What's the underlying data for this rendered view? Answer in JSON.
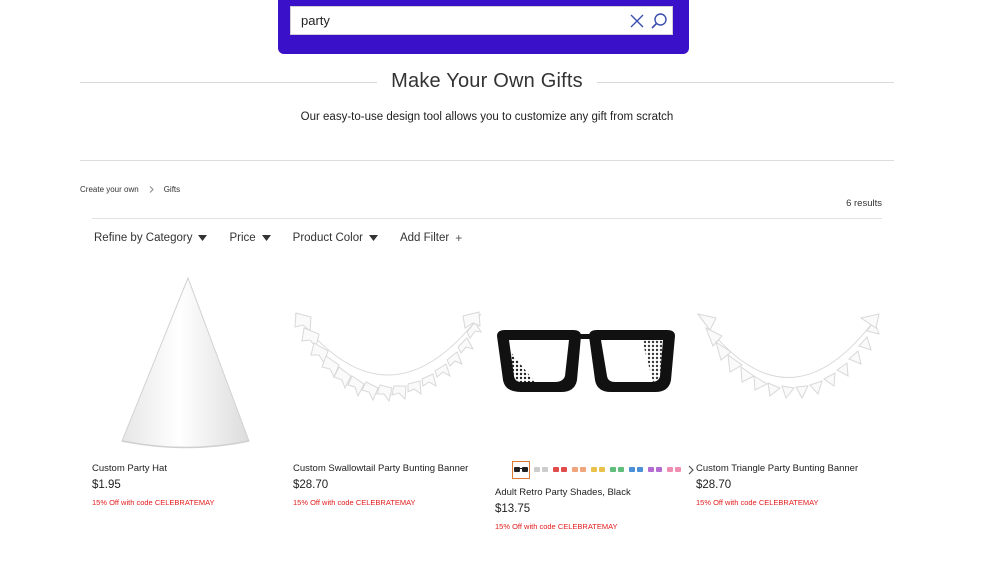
{
  "search": {
    "value": "party",
    "colors": {
      "band": "#3b10c9"
    }
  },
  "header": {
    "title": "Make Your Own Gifts",
    "subtitle": "Our easy-to-use design tool allows you to customize any gift from scratch"
  },
  "breadcrumb": {
    "items": [
      "Create your own",
      "Gifts"
    ]
  },
  "results": {
    "count_label": "6 results"
  },
  "filters": {
    "category": "Refine by Category",
    "price": "Price",
    "color": "Product Color",
    "add": "Add Filter"
  },
  "products": [
    {
      "name": "Custom Party Hat",
      "price": "$1.95",
      "promo": "15% Off with code CELEBRATEMAY",
      "icon": "party-hat-image"
    },
    {
      "name": "Custom Swallowtail Party Bunting Banner",
      "price": "$28.70",
      "promo": "15% Off with code CELEBRATEMAY",
      "icon": "swallowtail-bunting-image"
    },
    {
      "name": "Adult Retro Party Shades, Black",
      "price": "$13.75",
      "promo": "15% Off with code CELEBRATEMAY",
      "icon": "party-shades-image"
    },
    {
      "name": "Custom Triangle Party Bunting Banner",
      "price": "$28.70",
      "promo": "15% Off with code CELEBRATEMAY",
      "icon": "triangle-bunting-image"
    }
  ],
  "swatch_colors": [
    "#222222",
    "#cccccc",
    "#e24b4b",
    "#f0a57d",
    "#e8c24a",
    "#5fbf7a",
    "#4a90d9",
    "#b36ad1",
    "#f28db2"
  ],
  "colors": {
    "promo": "#e31b1b",
    "accent": "#3b10c9",
    "selected_swatch": "#e07a2f"
  }
}
